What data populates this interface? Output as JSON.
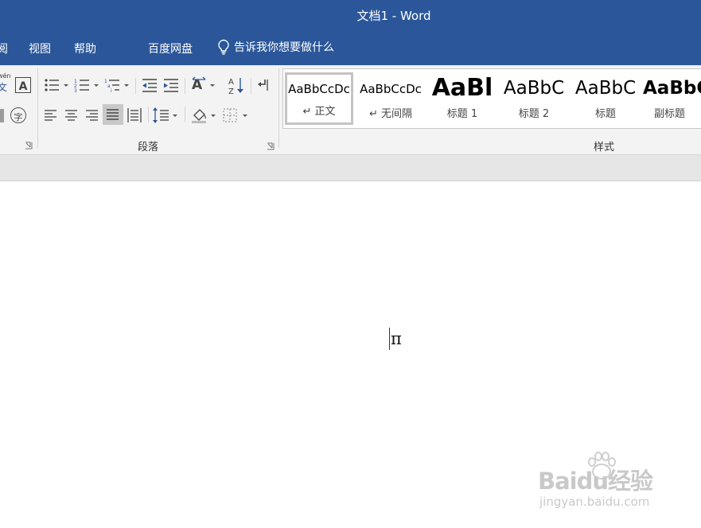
{
  "window": {
    "title": "文档1  -  Word"
  },
  "colors": {
    "titlebar": "#2b579a",
    "ribbon": "#f3f3f3",
    "strip": "#e6e6e6"
  },
  "menu": {
    "partial_tab": "阅",
    "view": "视图",
    "help": "帮助",
    "baidu_netdisk": "百度网盘",
    "tell_me": "告诉我你想要做什么"
  },
  "ribbon": {
    "paragraph_group": "段落",
    "styles_group": "样式",
    "font_icons": [
      "phonetic-guide-icon",
      "character-border-icon",
      "character-shading-icon",
      "enclose-characters-icon"
    ],
    "pinyin_glyph": "文",
    "pinyin_small": "wén",
    "char_border_glyph": "A",
    "enclose_glyph": "字"
  },
  "styles": [
    {
      "sample": "AaBbCcDc",
      "name": "↵ 正文",
      "selected": true
    },
    {
      "sample": "AaBbCcDc",
      "name": "↵ 无间隔",
      "selected": false
    },
    {
      "sample": "AaBl",
      "name": "标题 1",
      "selected": false
    },
    {
      "sample": "AaBbC",
      "name": "标题 2",
      "selected": false
    },
    {
      "sample": "AaBbC",
      "name": "标题",
      "selected": false
    },
    {
      "sample": "AaBbC",
      "name": "副标题",
      "selected": false
    }
  ],
  "document": {
    "text": "π"
  },
  "watermark": {
    "brand": "Baidu经验",
    "url": "jingyan.baidu.com"
  }
}
